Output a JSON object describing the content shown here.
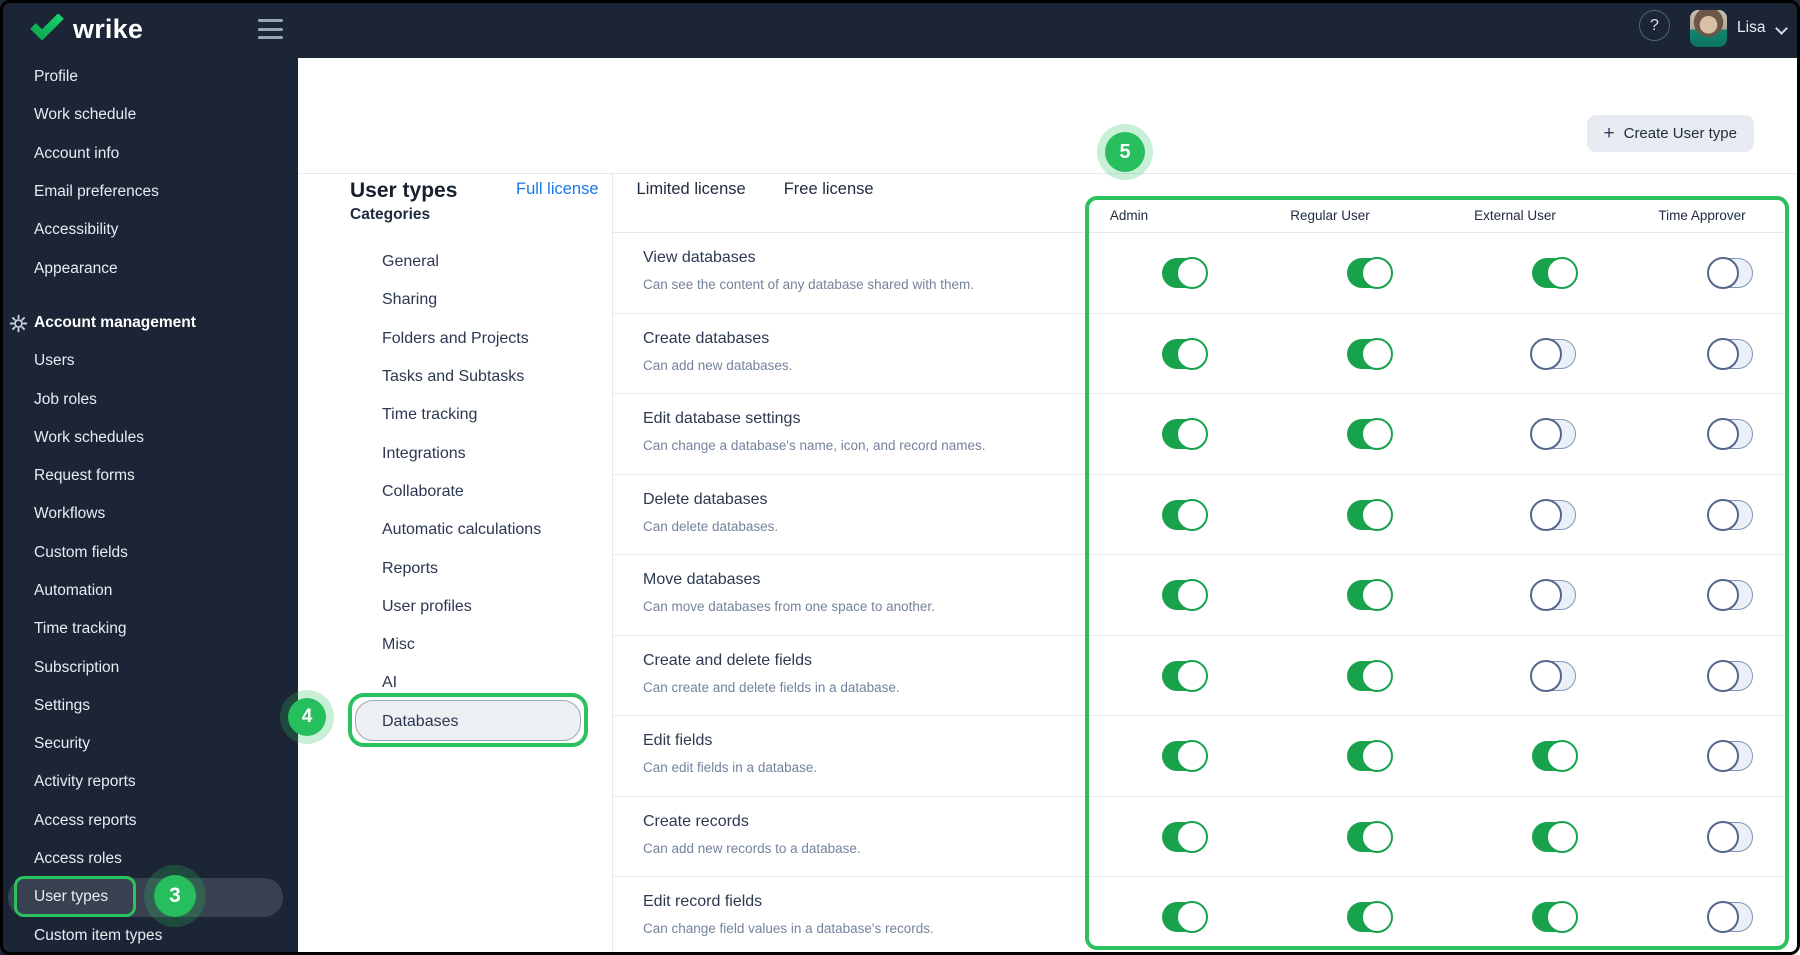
{
  "topbar": {
    "brand": "wrike",
    "help_glyph": "?",
    "user_name": "Lisa"
  },
  "sidebar": {
    "items": [
      {
        "label": "Profile"
      },
      {
        "label": "Work schedule"
      },
      {
        "label": "Account info"
      },
      {
        "label": "Email preferences"
      },
      {
        "label": "Accessibility"
      },
      {
        "label": "Appearance"
      },
      {
        "label": "Account management",
        "section": true
      },
      {
        "label": "Users"
      },
      {
        "label": "Job roles"
      },
      {
        "label": "Work schedules"
      },
      {
        "label": "Request forms"
      },
      {
        "label": "Workflows"
      },
      {
        "label": "Custom fields"
      },
      {
        "label": "Automation"
      },
      {
        "label": "Time tracking"
      },
      {
        "label": "Subscription"
      },
      {
        "label": "Settings"
      },
      {
        "label": "Security"
      },
      {
        "label": "Activity reports"
      },
      {
        "label": "Access reports"
      },
      {
        "label": "Access roles"
      },
      {
        "label": "User types",
        "selected": true
      },
      {
        "label": "Custom item types"
      }
    ]
  },
  "header": {
    "title": "User types",
    "tabs": [
      {
        "label": "Full license",
        "active": true
      },
      {
        "label": "Limited license",
        "active": false
      },
      {
        "label": "Free license",
        "active": false
      }
    ],
    "create_button": {
      "plus_glyph": "+",
      "label": "Create User type"
    }
  },
  "categories": {
    "heading": "Categories",
    "items": [
      {
        "label": "General"
      },
      {
        "label": "Sharing"
      },
      {
        "label": "Folders and Projects"
      },
      {
        "label": "Tasks and Subtasks"
      },
      {
        "label": "Time tracking"
      },
      {
        "label": "Integrations"
      },
      {
        "label": "Collaborate"
      },
      {
        "label": "Automatic calculations"
      },
      {
        "label": "Reports"
      },
      {
        "label": "User profiles"
      },
      {
        "label": "Misc"
      },
      {
        "label": "AI"
      },
      {
        "label": "Databases",
        "selected": true
      }
    ]
  },
  "table": {
    "columns": [
      "Admin",
      "Regular User",
      "External User",
      "Time Approver"
    ],
    "rows": [
      {
        "title": "View databases",
        "description": "Can see the content of any database shared with them.",
        "toggles": [
          true,
          true,
          true,
          false
        ]
      },
      {
        "title": "Create databases",
        "description": "Can add new databases.",
        "toggles": [
          true,
          true,
          false,
          false
        ]
      },
      {
        "title": "Edit database settings",
        "description": "Can change a database's name, icon, and record names.",
        "toggles": [
          true,
          true,
          false,
          false
        ]
      },
      {
        "title": "Delete databases",
        "description": "Can delete databases.",
        "toggles": [
          true,
          true,
          false,
          false
        ]
      },
      {
        "title": "Move databases",
        "description": "Can move databases from one space to another.",
        "toggles": [
          true,
          true,
          false,
          false
        ]
      },
      {
        "title": "Create and delete fields",
        "description": "Can create and delete fields in a database.",
        "toggles": [
          true,
          true,
          false,
          false
        ]
      },
      {
        "title": "Edit fields",
        "description": "Can edit fields in a database.",
        "toggles": [
          true,
          true,
          true,
          false
        ]
      },
      {
        "title": "Create records",
        "description": "Can add new records to a database.",
        "toggles": [
          true,
          true,
          true,
          false
        ]
      },
      {
        "title": "Edit record fields",
        "description": "Can change field values in a database's records.",
        "toggles": [
          true,
          true,
          true,
          false
        ]
      }
    ]
  },
  "annotations": {
    "step3": "3",
    "step4": "4",
    "step5": "5"
  },
  "colors": {
    "navy": "#1B2535",
    "toggle_on_green": "#17A24B",
    "annotation_green": "#2BC15F",
    "active_tab_blue": "#1A78E8"
  }
}
